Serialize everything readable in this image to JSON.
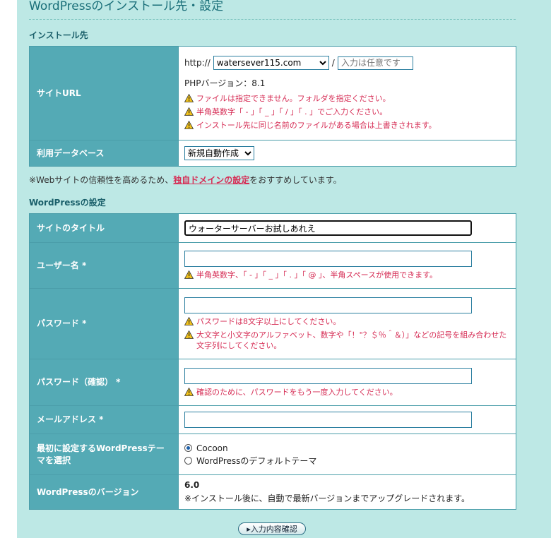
{
  "page_title": "WordPressのインストール先・設定",
  "install_section": {
    "heading": "インストール先",
    "site_url_label": "サイトURL",
    "protocol": "http://",
    "domain_selected": "watersever115.com",
    "slash": "/",
    "path_placeholder": "入力は任意です",
    "php_version": "PHPバージョン：8.1",
    "warnings": [
      "ファイルは指定できません。フォルダを指定ください。",
      "半角英数字「 - 」「 _ 」「 / 」「 . 」でご入力ください。",
      "インストール先に同じ名前のファイルがある場合は上書きされます。"
    ],
    "db_label": "利用データベース",
    "db_selected": "新規自動作成"
  },
  "notice": {
    "prefix": "※Webサイトの信頼性を高めるため、",
    "link": "独自ドメインの設定",
    "suffix": "をおすすめしています。"
  },
  "wp_section": {
    "heading": "WordPressの設定",
    "site_title_label": "サイトのタイトル",
    "site_title_value": "ウォーターサーバーお試しあれえ",
    "username_label": "ユーザー名 *",
    "username_warning": "半角英数字、「 - 」「 _ 」「 . 」「 @ 」、半角スペースが使用できます。",
    "password_label": "パスワード *",
    "password_warnings": [
      "パスワードは8文字以上にしてください。",
      "大文字と小文字のアルファベット、数字や「！\"？＄％＾＆）」などの記号を組み合わせた文字列にしてください。"
    ],
    "password_confirm_label": "パスワード（確認） *",
    "password_confirm_warning": "確認のために、パスワードをもう一度入力してください。",
    "email_label": "メールアドレス *",
    "theme_label": "最初に設定するWordPressテーマを選択",
    "theme_options": [
      "Cocoon",
      "WordPressのデフォルトテーマ"
    ],
    "version_label": "WordPressのバージョン",
    "version_value": "6.0",
    "version_note": "※インストール後に、自動で最新バージョンまでアップグレードされます。"
  },
  "submit_label": "▸入力内容確認",
  "colors": {
    "panel_bg": "#bde8e5",
    "label_bg": "#54aab5",
    "warning": "#d62d55",
    "title": "#1a6f79"
  }
}
